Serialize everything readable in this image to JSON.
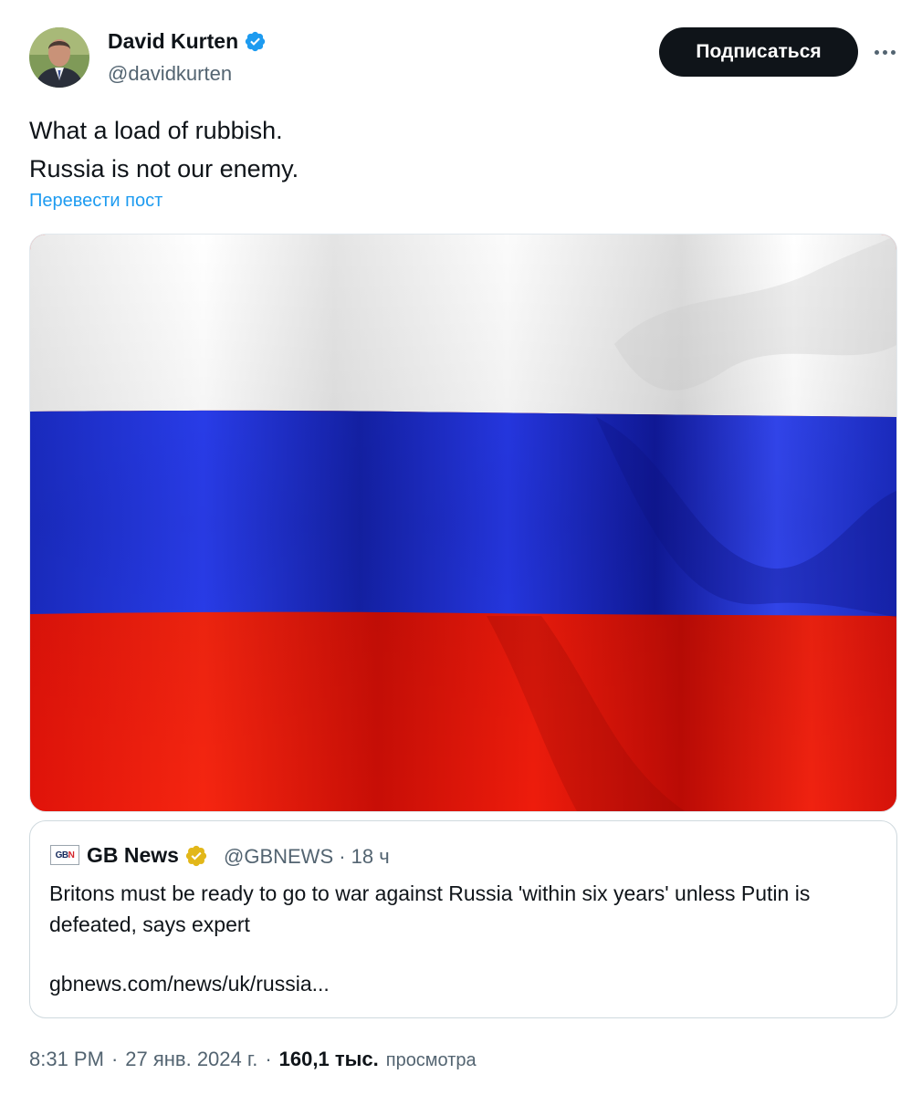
{
  "author": {
    "name": "David Kurten",
    "handle": "@davidkurten",
    "verified": true
  },
  "actions": {
    "follow_label": "Подписаться"
  },
  "tweet": {
    "lines": [
      "What a load of rubbish.",
      "Russia is not our enemy."
    ],
    "translate_label": "Перевести пост"
  },
  "media": {
    "description_icon": "russian-flag-image",
    "colors": {
      "white": "#f2f2f2",
      "blue": "#1c2fd6",
      "red": "#e8150b"
    }
  },
  "quote": {
    "logo_text_blue": "GB",
    "logo_text_red": "N",
    "name": "GB News",
    "handle_time": "@GBNEWS · 18 ч",
    "text": "Britons must be ready to go to war against Russia 'within six years' unless Putin is defeated, says expert",
    "link": "gbnews.com/news/uk/russia..."
  },
  "footer": {
    "time": "8:31 PM",
    "date": "27 янв. 2024 г.",
    "views_count": "160,1 тыс.",
    "views_label": "просмотра"
  },
  "colors": {
    "accent": "#1d9bf0",
    "verified_blue": "#1d9bf0",
    "verified_gold": "#e2b719",
    "text_primary": "#0f1419",
    "text_secondary": "#536471"
  }
}
